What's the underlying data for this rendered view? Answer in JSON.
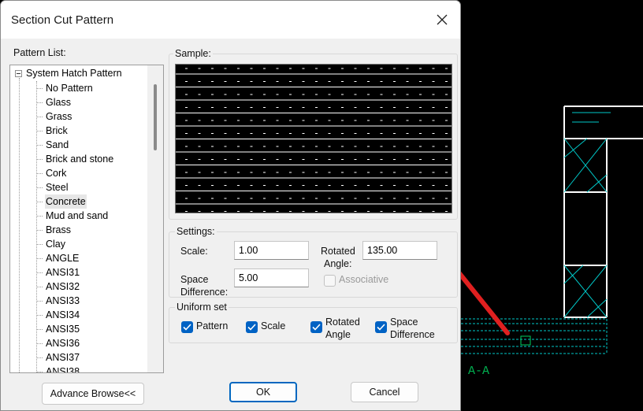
{
  "dialog": {
    "title": "Section Cut Pattern",
    "close_glyph": "✕"
  },
  "pattern_list": {
    "label": "Pattern List:",
    "root": "System Hatch Pattern",
    "items": [
      {
        "label": "No Pattern",
        "selected": false
      },
      {
        "label": "Glass",
        "selected": false
      },
      {
        "label": "Grass",
        "selected": false
      },
      {
        "label": "Brick",
        "selected": false
      },
      {
        "label": "Sand",
        "selected": false
      },
      {
        "label": "Brick and stone",
        "selected": false
      },
      {
        "label": "Cork",
        "selected": false
      },
      {
        "label": "Steel",
        "selected": false
      },
      {
        "label": "Concrete",
        "selected": true
      },
      {
        "label": "Mud and sand",
        "selected": false
      },
      {
        "label": "Brass",
        "selected": false
      },
      {
        "label": "Clay",
        "selected": false
      },
      {
        "label": "ANGLE",
        "selected": false
      },
      {
        "label": "ANSI31",
        "selected": false
      },
      {
        "label": "ANSI32",
        "selected": false
      },
      {
        "label": "ANSI33",
        "selected": false
      },
      {
        "label": "ANSI34",
        "selected": false
      },
      {
        "label": "ANSI35",
        "selected": false
      },
      {
        "label": "ANSI36",
        "selected": false
      },
      {
        "label": "ANSI37",
        "selected": false
      },
      {
        "label": "ANSI38",
        "selected": false
      }
    ]
  },
  "sample": {
    "label": "Sample:"
  },
  "settings": {
    "label": "Settings:",
    "scale_label": "Scale:",
    "scale_value": "1.00",
    "rotated_label_1": "Rotated",
    "rotated_label_2": "Angle:",
    "rotated_value": "135.00",
    "space_label_1": "Space",
    "space_label_2": "Difference:",
    "space_value": "5.00",
    "associative_label": "Associative",
    "associative_checked": false
  },
  "uniform_set": {
    "label": "Uniform set",
    "pattern_label": "Pattern",
    "scale_label": "Scale",
    "rotated_label_1": "Rotated",
    "rotated_label_2": "Angle",
    "space_label_1": "Space",
    "space_label_2": "Difference"
  },
  "buttons": {
    "advance_browse": "Advance Browse<<",
    "ok": "OK",
    "cancel": "Cancel"
  },
  "cad": {
    "section_label": "A-A",
    "line_color": "#00c8c8",
    "wall_color": "#ffffff",
    "label_color": "#00b050",
    "pointer_color": "#e02020"
  }
}
